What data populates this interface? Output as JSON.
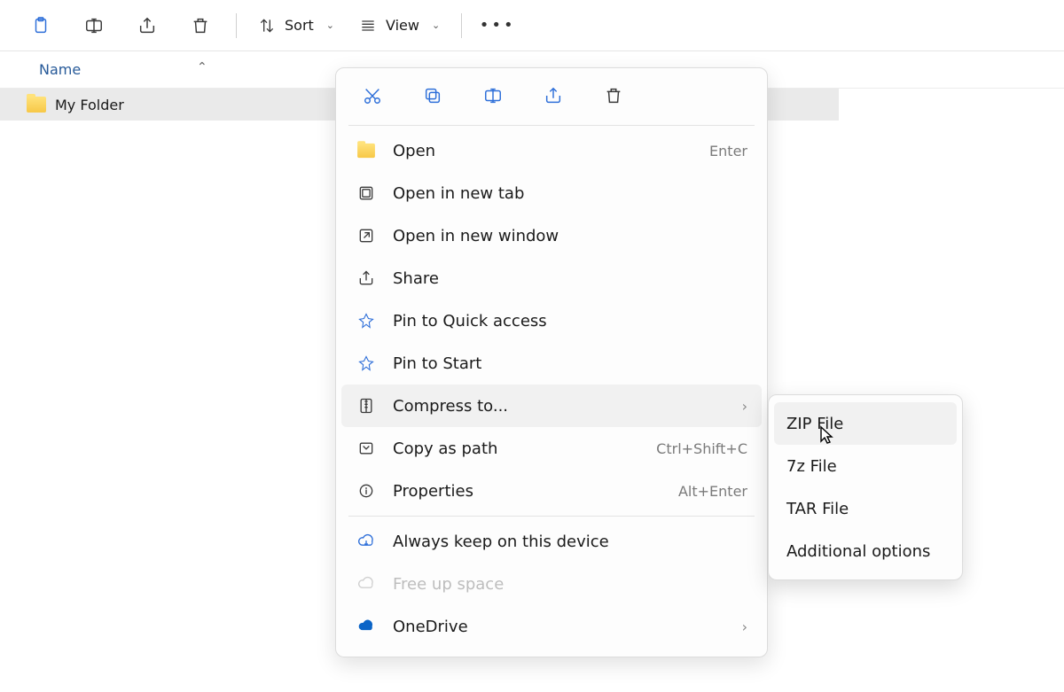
{
  "toolbar": {
    "sort_label": "Sort",
    "view_label": "View"
  },
  "columns": {
    "name": "Name"
  },
  "items": [
    {
      "name": "My Folder"
    }
  ],
  "context_menu": {
    "open": {
      "label": "Open",
      "shortcut": "Enter"
    },
    "open_tab": {
      "label": "Open in new tab"
    },
    "open_window": {
      "label": "Open in new window"
    },
    "share": {
      "label": "Share"
    },
    "pin_quick": {
      "label": "Pin to Quick access"
    },
    "pin_start": {
      "label": "Pin to Start"
    },
    "compress": {
      "label": "Compress to..."
    },
    "copy_path": {
      "label": "Copy as path",
      "shortcut": "Ctrl+Shift+C"
    },
    "properties": {
      "label": "Properties",
      "shortcut": "Alt+Enter"
    },
    "always_keep": {
      "label": "Always keep on this device"
    },
    "free_up": {
      "label": "Free up space"
    },
    "onedrive": {
      "label": "OneDrive"
    }
  },
  "compress_submenu": {
    "zip": "ZIP File",
    "sevenz": "7z File",
    "tar": "TAR File",
    "more": "Additional options"
  }
}
